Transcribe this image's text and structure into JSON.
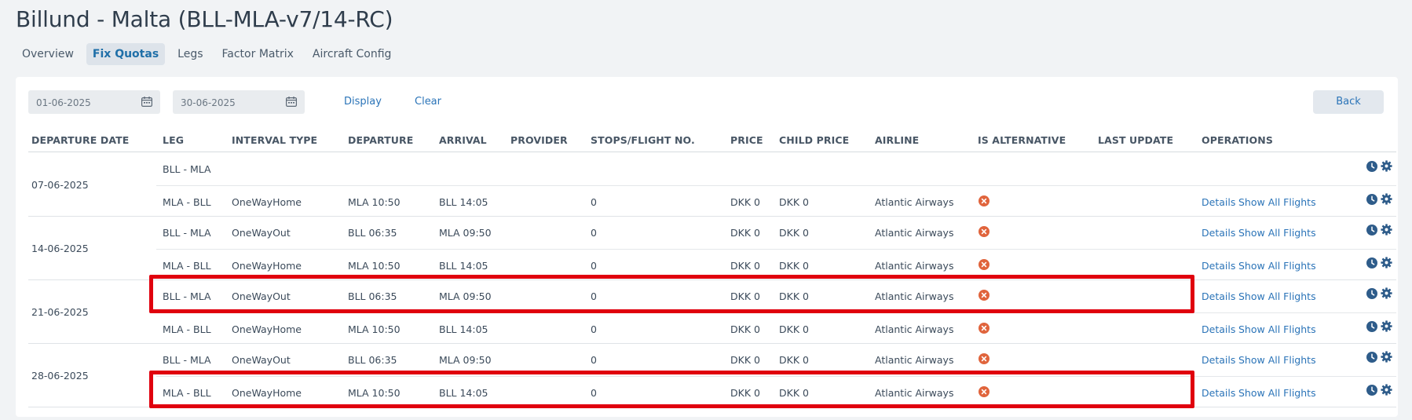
{
  "title": "Billund - Malta (BLL-MLA-v7/14-RC)",
  "tabs": [
    {
      "label": "Overview",
      "active": false
    },
    {
      "label": "Fix Quotas",
      "active": true
    },
    {
      "label": "Legs",
      "active": false
    },
    {
      "label": "Factor Matrix",
      "active": false
    },
    {
      "label": "Aircraft Config",
      "active": false
    }
  ],
  "filters": {
    "from_date": "01-06-2025",
    "to_date": "30-06-2025",
    "display_label": "Display",
    "clear_label": "Clear",
    "back_label": "Back"
  },
  "columns": {
    "departure_date": "DEPARTURE DATE",
    "leg": "LEG",
    "interval_type": "INTERVAL TYPE",
    "departure": "DEPARTURE",
    "arrival": "ARRIVAL",
    "provider": "PROVIDER",
    "stops": "STOPS/FLIGHT NO.",
    "price": "PRICE",
    "child_price": "CHILD PRICE",
    "airline": "AIRLINE",
    "is_alternative": "IS ALTERNATIVE",
    "last_update": "LAST UPDATE",
    "operations": "OPERATIONS"
  },
  "operations": {
    "details": "Details",
    "show_all": "Show All Flights"
  },
  "groups": [
    {
      "date": "07-06-2025",
      "rows": [
        {
          "leg": "BLL - MLA",
          "interval": "",
          "departure": "",
          "arrival": "",
          "provider": "",
          "stops": "",
          "price": "",
          "child_price": "",
          "airline": "",
          "alternative": false,
          "last_update": "",
          "has_links": false,
          "highlighted": false
        },
        {
          "leg": "MLA - BLL",
          "interval": "OneWayHome",
          "departure": "MLA 10:50",
          "arrival": "BLL 14:05",
          "provider": "",
          "stops": "0",
          "price": "DKK 0",
          "child_price": "DKK 0",
          "airline": "Atlantic Airways",
          "alternative": true,
          "last_update": "",
          "has_links": true,
          "highlighted": false
        }
      ]
    },
    {
      "date": "14-06-2025",
      "rows": [
        {
          "leg": "BLL - MLA",
          "interval": "OneWayOut",
          "departure": "BLL 06:35",
          "arrival": "MLA 09:50",
          "provider": "",
          "stops": "0",
          "price": "DKK 0",
          "child_price": "DKK 0",
          "airline": "Atlantic Airways",
          "alternative": true,
          "last_update": "",
          "has_links": true,
          "highlighted": false
        },
        {
          "leg": "MLA - BLL",
          "interval": "OneWayHome",
          "departure": "MLA 10:50",
          "arrival": "BLL 14:05",
          "provider": "",
          "stops": "0",
          "price": "DKK 0",
          "child_price": "DKK 0",
          "airline": "Atlantic Airways",
          "alternative": true,
          "last_update": "",
          "has_links": true,
          "highlighted": false
        }
      ]
    },
    {
      "date": "21-06-2025",
      "rows": [
        {
          "leg": "BLL - MLA",
          "interval": "OneWayOut",
          "departure": "BLL 06:35",
          "arrival": "MLA 09:50",
          "provider": "",
          "stops": "0",
          "price": "DKK 0",
          "child_price": "DKK 0",
          "airline": "Atlantic Airways",
          "alternative": true,
          "last_update": "",
          "has_links": true,
          "highlighted": true
        },
        {
          "leg": "MLA - BLL",
          "interval": "OneWayHome",
          "departure": "MLA 10:50",
          "arrival": "BLL 14:05",
          "provider": "",
          "stops": "0",
          "price": "DKK 0",
          "child_price": "DKK 0",
          "airline": "Atlantic Airways",
          "alternative": true,
          "last_update": "",
          "has_links": true,
          "highlighted": false
        }
      ]
    },
    {
      "date": "28-06-2025",
      "rows": [
        {
          "leg": "BLL - MLA",
          "interval": "OneWayOut",
          "departure": "BLL 06:35",
          "arrival": "MLA 09:50",
          "provider": "",
          "stops": "0",
          "price": "DKK 0",
          "child_price": "DKK 0",
          "airline": "Atlantic Airways",
          "alternative": true,
          "last_update": "",
          "has_links": true,
          "highlighted": false
        },
        {
          "leg": "MLA - BLL",
          "interval": "OneWayHome",
          "departure": "MLA 10:50",
          "arrival": "BLL 14:05",
          "provider": "",
          "stops": "0",
          "price": "DKK 0",
          "child_price": "DKK 0",
          "airline": "Atlantic Airways",
          "alternative": true,
          "last_update": "",
          "has_links": true,
          "highlighted": true
        }
      ]
    }
  ],
  "colors": {
    "accent_link": "#2b74b8",
    "alternative_icon": "#e0643c",
    "highlight_box": "#e0000e",
    "ops_icon": "#2e5c8a"
  },
  "icons": {
    "calendar": "calendar-icon",
    "alternative": "x-circle-icon",
    "history": "clock-icon",
    "settings": "gear-icon"
  }
}
